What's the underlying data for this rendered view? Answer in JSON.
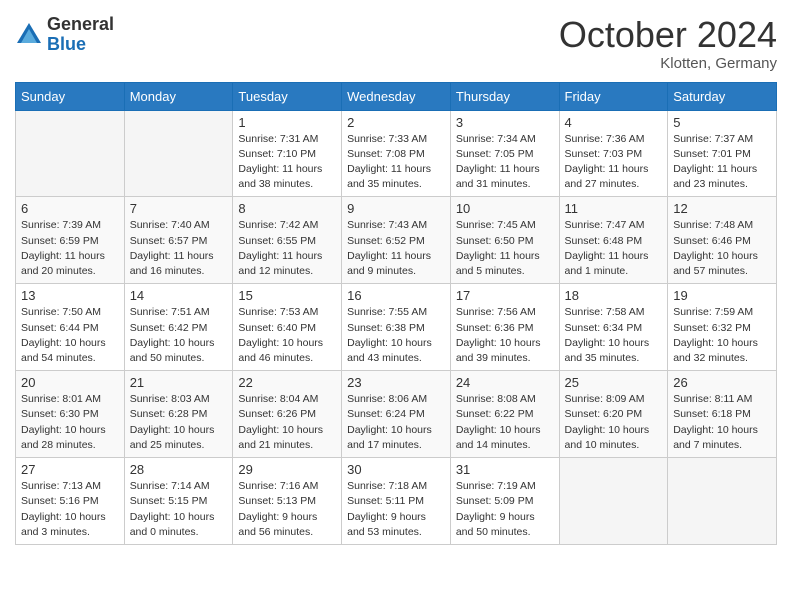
{
  "logo": {
    "general": "General",
    "blue": "Blue"
  },
  "title": "October 2024",
  "location": "Klotten, Germany",
  "days_of_week": [
    "Sunday",
    "Monday",
    "Tuesday",
    "Wednesday",
    "Thursday",
    "Friday",
    "Saturday"
  ],
  "weeks": [
    [
      {
        "day": "",
        "info": ""
      },
      {
        "day": "",
        "info": ""
      },
      {
        "day": "1",
        "info": "Sunrise: 7:31 AM\nSunset: 7:10 PM\nDaylight: 11 hours and 38 minutes."
      },
      {
        "day": "2",
        "info": "Sunrise: 7:33 AM\nSunset: 7:08 PM\nDaylight: 11 hours and 35 minutes."
      },
      {
        "day": "3",
        "info": "Sunrise: 7:34 AM\nSunset: 7:05 PM\nDaylight: 11 hours and 31 minutes."
      },
      {
        "day": "4",
        "info": "Sunrise: 7:36 AM\nSunset: 7:03 PM\nDaylight: 11 hours and 27 minutes."
      },
      {
        "day": "5",
        "info": "Sunrise: 7:37 AM\nSunset: 7:01 PM\nDaylight: 11 hours and 23 minutes."
      }
    ],
    [
      {
        "day": "6",
        "info": "Sunrise: 7:39 AM\nSunset: 6:59 PM\nDaylight: 11 hours and 20 minutes."
      },
      {
        "day": "7",
        "info": "Sunrise: 7:40 AM\nSunset: 6:57 PM\nDaylight: 11 hours and 16 minutes."
      },
      {
        "day": "8",
        "info": "Sunrise: 7:42 AM\nSunset: 6:55 PM\nDaylight: 11 hours and 12 minutes."
      },
      {
        "day": "9",
        "info": "Sunrise: 7:43 AM\nSunset: 6:52 PM\nDaylight: 11 hours and 9 minutes."
      },
      {
        "day": "10",
        "info": "Sunrise: 7:45 AM\nSunset: 6:50 PM\nDaylight: 11 hours and 5 minutes."
      },
      {
        "day": "11",
        "info": "Sunrise: 7:47 AM\nSunset: 6:48 PM\nDaylight: 11 hours and 1 minute."
      },
      {
        "day": "12",
        "info": "Sunrise: 7:48 AM\nSunset: 6:46 PM\nDaylight: 10 hours and 57 minutes."
      }
    ],
    [
      {
        "day": "13",
        "info": "Sunrise: 7:50 AM\nSunset: 6:44 PM\nDaylight: 10 hours and 54 minutes."
      },
      {
        "day": "14",
        "info": "Sunrise: 7:51 AM\nSunset: 6:42 PM\nDaylight: 10 hours and 50 minutes."
      },
      {
        "day": "15",
        "info": "Sunrise: 7:53 AM\nSunset: 6:40 PM\nDaylight: 10 hours and 46 minutes."
      },
      {
        "day": "16",
        "info": "Sunrise: 7:55 AM\nSunset: 6:38 PM\nDaylight: 10 hours and 43 minutes."
      },
      {
        "day": "17",
        "info": "Sunrise: 7:56 AM\nSunset: 6:36 PM\nDaylight: 10 hours and 39 minutes."
      },
      {
        "day": "18",
        "info": "Sunrise: 7:58 AM\nSunset: 6:34 PM\nDaylight: 10 hours and 35 minutes."
      },
      {
        "day": "19",
        "info": "Sunrise: 7:59 AM\nSunset: 6:32 PM\nDaylight: 10 hours and 32 minutes."
      }
    ],
    [
      {
        "day": "20",
        "info": "Sunrise: 8:01 AM\nSunset: 6:30 PM\nDaylight: 10 hours and 28 minutes."
      },
      {
        "day": "21",
        "info": "Sunrise: 8:03 AM\nSunset: 6:28 PM\nDaylight: 10 hours and 25 minutes."
      },
      {
        "day": "22",
        "info": "Sunrise: 8:04 AM\nSunset: 6:26 PM\nDaylight: 10 hours and 21 minutes."
      },
      {
        "day": "23",
        "info": "Sunrise: 8:06 AM\nSunset: 6:24 PM\nDaylight: 10 hours and 17 minutes."
      },
      {
        "day": "24",
        "info": "Sunrise: 8:08 AM\nSunset: 6:22 PM\nDaylight: 10 hours and 14 minutes."
      },
      {
        "day": "25",
        "info": "Sunrise: 8:09 AM\nSunset: 6:20 PM\nDaylight: 10 hours and 10 minutes."
      },
      {
        "day": "26",
        "info": "Sunrise: 8:11 AM\nSunset: 6:18 PM\nDaylight: 10 hours and 7 minutes."
      }
    ],
    [
      {
        "day": "27",
        "info": "Sunrise: 7:13 AM\nSunset: 5:16 PM\nDaylight: 10 hours and 3 minutes."
      },
      {
        "day": "28",
        "info": "Sunrise: 7:14 AM\nSunset: 5:15 PM\nDaylight: 10 hours and 0 minutes."
      },
      {
        "day": "29",
        "info": "Sunrise: 7:16 AM\nSunset: 5:13 PM\nDaylight: 9 hours and 56 minutes."
      },
      {
        "day": "30",
        "info": "Sunrise: 7:18 AM\nSunset: 5:11 PM\nDaylight: 9 hours and 53 minutes."
      },
      {
        "day": "31",
        "info": "Sunrise: 7:19 AM\nSunset: 5:09 PM\nDaylight: 9 hours and 50 minutes."
      },
      {
        "day": "",
        "info": ""
      },
      {
        "day": "",
        "info": ""
      }
    ]
  ]
}
